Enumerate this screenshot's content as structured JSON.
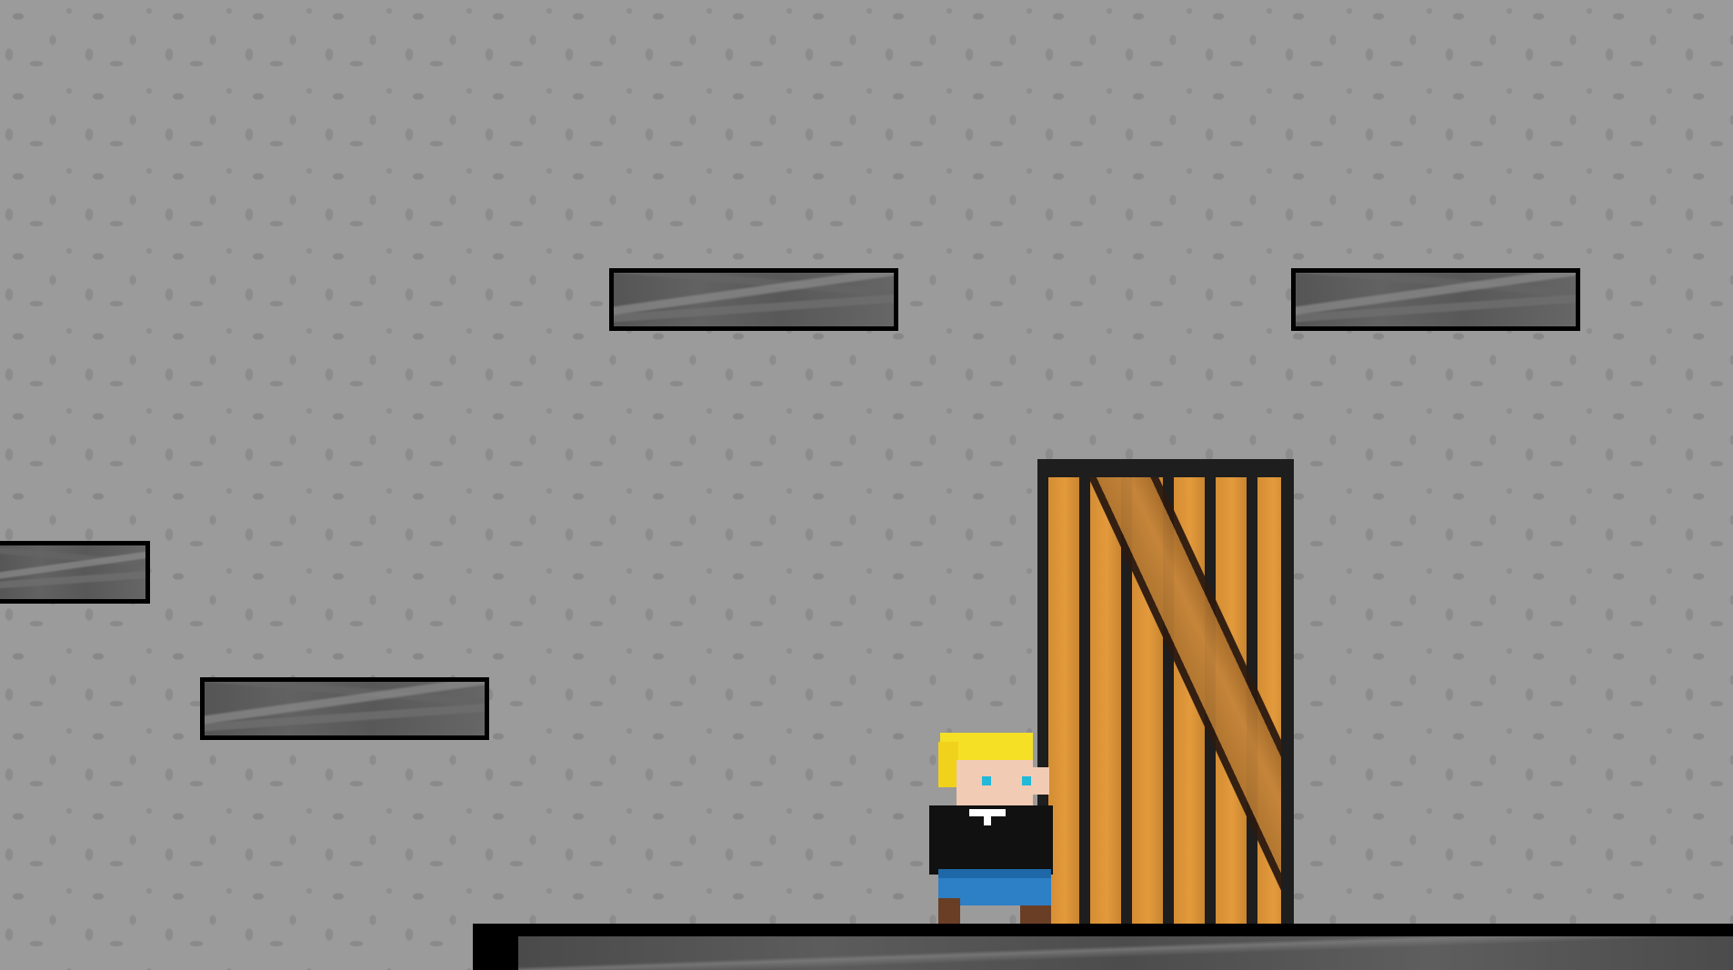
{
  "scene": {
    "theme": "stone-dungeon",
    "background_color": "#9b9b9b",
    "objects": [
      {
        "kind": "ledge",
        "name": "ledge-upper-left"
      },
      {
        "kind": "ledge",
        "name": "ledge-upper-right"
      },
      {
        "kind": "ledge",
        "name": "ledge-left-edge"
      },
      {
        "kind": "ledge",
        "name": "ledge-lower-left"
      },
      {
        "kind": "door",
        "name": "wooden-door",
        "material": "wood",
        "plank_color": "#e39a3c"
      },
      {
        "kind": "player",
        "name": "player-character",
        "hair_color": "#f5e025",
        "shirt_color": "#111111",
        "pants_color": "#2d7fc6"
      }
    ]
  }
}
